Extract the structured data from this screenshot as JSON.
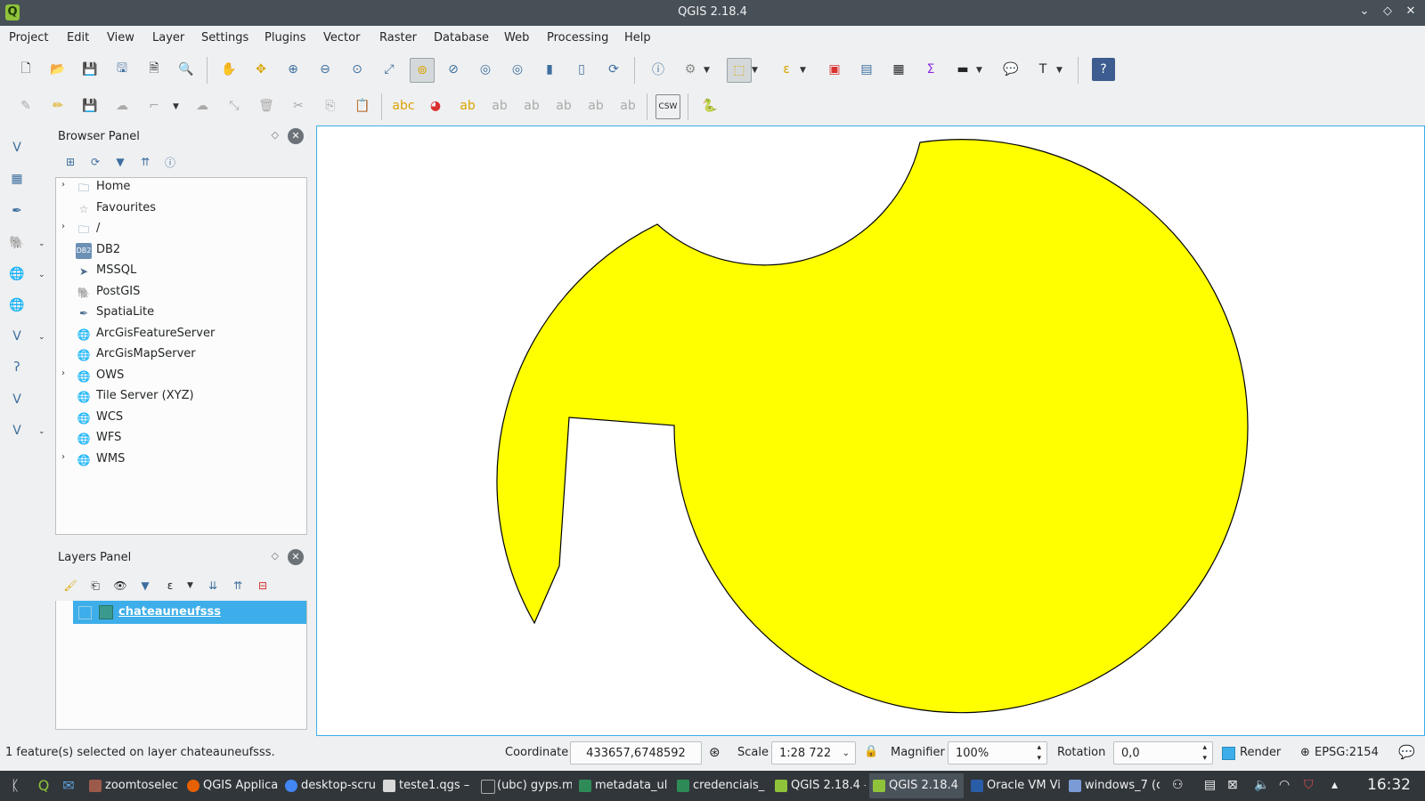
{
  "window": {
    "title": "QGIS 2.18.4",
    "app_icon": "Q"
  },
  "menubar": [
    "Project",
    "Edit",
    "View",
    "Layer",
    "Settings",
    "Plugins",
    "Vector",
    "Raster",
    "Database",
    "Web",
    "Processing",
    "Help"
  ],
  "browser_panel": {
    "title": "Browser Panel",
    "items": [
      {
        "label": "Home",
        "icon": "folder-icon",
        "expandable": true
      },
      {
        "label": "Favourites",
        "icon": "star-icon",
        "expandable": false
      },
      {
        "label": "/",
        "icon": "folder-icon",
        "expandable": true
      },
      {
        "label": "DB2",
        "icon": "db2-icon",
        "expandable": false
      },
      {
        "label": "MSSQL",
        "icon": "mssql-icon",
        "expandable": false
      },
      {
        "label": "PostGIS",
        "icon": "postgis-icon",
        "expandable": false
      },
      {
        "label": "SpatiaLite",
        "icon": "spatialite-icon",
        "expandable": false
      },
      {
        "label": "ArcGisFeatureServer",
        "icon": "globe-icon",
        "expandable": false
      },
      {
        "label": "ArcGisMapServer",
        "icon": "globe-icon",
        "expandable": false
      },
      {
        "label": "OWS",
        "icon": "globe-icon",
        "expandable": true
      },
      {
        "label": "Tile Server (XYZ)",
        "icon": "globe-icon",
        "expandable": false
      },
      {
        "label": "WCS",
        "icon": "globe-icon",
        "expandable": false
      },
      {
        "label": "WFS",
        "icon": "globe-icon",
        "expandable": false
      },
      {
        "label": "WMS",
        "icon": "globe-icon",
        "expandable": true
      }
    ]
  },
  "layers_panel": {
    "title": "Layers Panel",
    "layers": [
      {
        "name": "chateauneufsss",
        "selected": true,
        "color": "#3a9a8e"
      }
    ]
  },
  "map": {
    "fill_color": "#ffff00",
    "stroke_color": "#000000"
  },
  "statusbar": {
    "message": "1 feature(s) selected on layer chateauneufsss.",
    "coordinate_label": "Coordinate",
    "coordinate_value": "433657,6748592",
    "scale_label": "Scale",
    "scale_value": "1:28 722",
    "magnifier_label": "Magnifier",
    "magnifier_value": "100%",
    "rotation_label": "Rotation",
    "rotation_value": "0,0",
    "render_label": "Render",
    "crs": "EPSG:2154"
  },
  "taskbar": {
    "tasks": [
      {
        "label": "zoomtoselec",
        "active": false,
        "color": "#9c5a4a"
      },
      {
        "label": "QGIS Applica",
        "active": false,
        "color": "#e66000"
      },
      {
        "label": "desktop-scru",
        "active": false,
        "color": "#4285f4"
      },
      {
        "label": "teste1.qgs –",
        "active": false,
        "color": "#d9d9d9"
      },
      {
        "label": "(ubc) gyps.m",
        "active": false,
        "color": "#31363b"
      },
      {
        "label": "metadata_ul",
        "active": false,
        "color": "#2e8b57"
      },
      {
        "label": "credenciais_",
        "active": false,
        "color": "#2e8b57"
      },
      {
        "label": "QGIS 2.18.4 –",
        "active": false,
        "color": "#8fc33a"
      },
      {
        "label": "QGIS 2.18.4",
        "active": true,
        "color": "#8fc33a"
      },
      {
        "label": "Oracle VM Vi",
        "active": false,
        "color": "#2a5da8"
      },
      {
        "label": "windows_7 (c",
        "active": false,
        "color": "#7a9bd6"
      }
    ],
    "clock": "16:32"
  }
}
